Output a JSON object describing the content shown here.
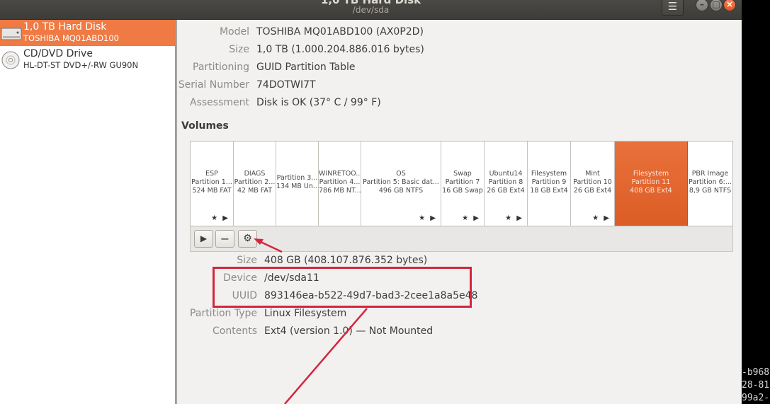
{
  "window": {
    "title": "1,0 TB Hard Disk",
    "subtitle": "/dev/sda",
    "menu_icon": "hamburger-icon",
    "controls": {
      "minimize": "–",
      "maximize": "□",
      "close": "×"
    }
  },
  "sidebar": {
    "items": [
      {
        "name": "1,0 TB Hard Disk",
        "model": "TOSHIBA MQ01ABD100",
        "icon": "hard-disk-icon",
        "selected": true
      },
      {
        "name": "CD/DVD Drive",
        "model": "HL-DT-ST DVD+/-RW GU90N",
        "icon": "optical-drive-icon",
        "selected": false
      }
    ]
  },
  "disk_info": {
    "model_label": "Model",
    "model_value": "TOSHIBA MQ01ABD100 (AX0P2D)",
    "size_label": "Size",
    "size_value": "1,0 TB (1.000.204.886.016 bytes)",
    "partitioning_label": "Partitioning",
    "partitioning_value": "GUID Partition Table",
    "serial_label": "Serial Number",
    "serial_value": "74DOTWI7T",
    "assessment_label": "Assessment",
    "assessment_value": "Disk is OK (37° C / 99° F)"
  },
  "volumes_heading": "Volumes",
  "volumes": [
    {
      "l1": "ESP",
      "l2": "Partition 1...",
      "l3": "524 MB FAT",
      "icons": "★ ▶"
    },
    {
      "l1": "DIAGS",
      "l2": "Partition 2...",
      "l3": "42 MB FAT",
      "icons": ""
    },
    {
      "l1": "Partition 3...",
      "l2": "134 MB Un...",
      "l3": "",
      "icons": ""
    },
    {
      "l1": "WINRETOO...",
      "l2": "Partition 4...",
      "l3": "786 MB NT...",
      "icons": ""
    },
    {
      "l1": "OS",
      "l2": "Partition 5: Basic dat...",
      "l3": "496 GB NTFS",
      "icons": "★ ▶"
    },
    {
      "l1": "Swap",
      "l2": "Partition 7",
      "l3": "16 GB Swap",
      "icons": "★ ▶"
    },
    {
      "l1": "Ubuntu14",
      "l2": "Partition 8",
      "l3": "26 GB Ext4",
      "icons": "★ ▶"
    },
    {
      "l1": "Filesystem",
      "l2": "Partition 9",
      "l3": "18 GB Ext4",
      "icons": ""
    },
    {
      "l1": "Mint",
      "l2": "Partition 10",
      "l3": "26 GB Ext4",
      "icons": "★ ▶"
    },
    {
      "l1": "Filesystem",
      "l2": "Partition 11",
      "l3": "408 GB Ext4",
      "icons": "",
      "selected": true
    },
    {
      "l1": "PBR Image",
      "l2": "Partition 6:...",
      "l3": "8,9 GB NTFS",
      "icons": ""
    }
  ],
  "volume_toolbar": {
    "play": "▶",
    "minus": "−",
    "gear": "⚙"
  },
  "partition_info": {
    "size_label": "Size",
    "size_value": "408 GB (408.107.876.352 bytes)",
    "device_label": "Device",
    "device_value": "/dev/sda11",
    "uuid_label": "UUID",
    "uuid_value": "893146ea-b522-49d7-bad3-2cee1a8a5e48",
    "ptype_label": "Partition Type",
    "ptype_value": "Linux Filesystem",
    "contents_label": "Contents",
    "contents_value": "Ext4 (version 1.0) — Not Mounted"
  },
  "terminal_snippet": [
    "-b968",
    "28-81",
    "99a2-"
  ],
  "colors": {
    "accent": "#e95e24",
    "annotation": "#d3263e"
  }
}
